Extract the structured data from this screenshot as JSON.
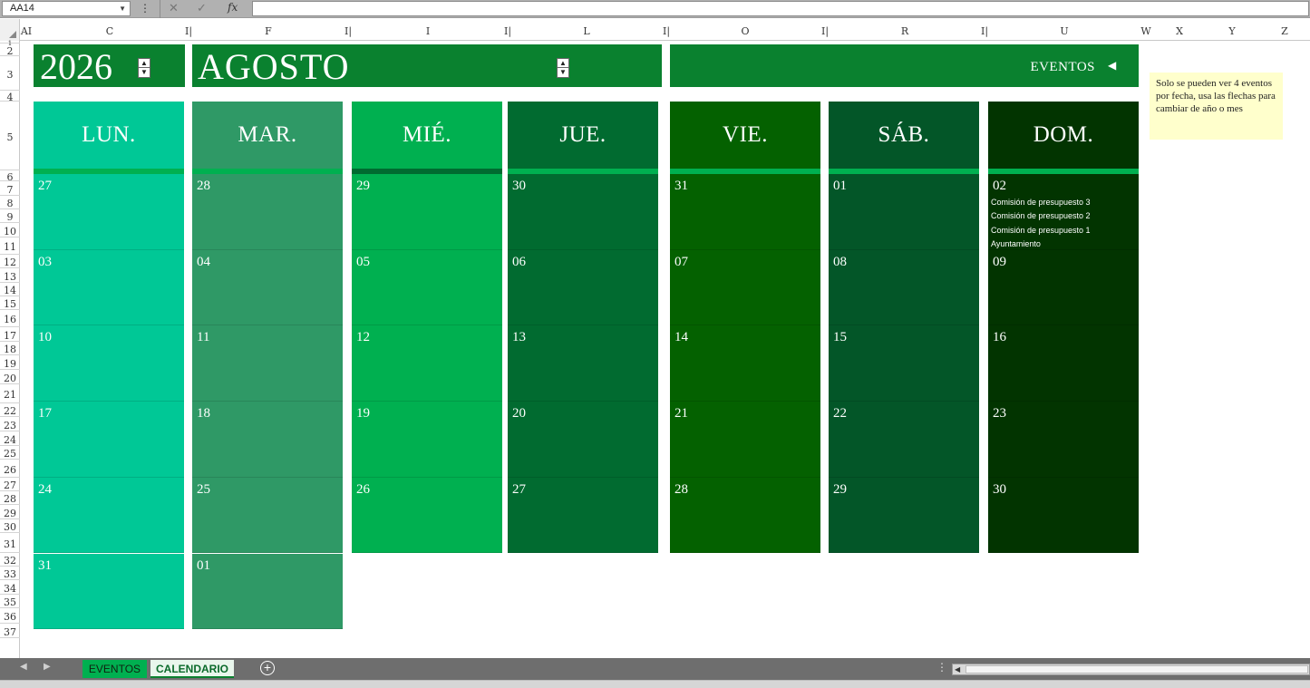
{
  "formula_bar": {
    "name_box": "AA14",
    "cancel_icon": "✕",
    "enter_icon": "✓",
    "fx_label": "fx",
    "formula": ""
  },
  "columns": [
    "AI",
    "C",
    "I|",
    "F",
    "I|",
    "I",
    "I|",
    "L",
    "I|",
    "O",
    "I|",
    "R",
    "I|",
    "U",
    "W",
    "X",
    "Y",
    "Z"
  ],
  "rows": [
    "1",
    "2",
    "3",
    "4",
    "5",
    "6",
    "7",
    "8",
    "9",
    "10",
    "11",
    "12",
    "13",
    "14",
    "15",
    "16",
    "17",
    "18",
    "19",
    "20",
    "21",
    "22",
    "23",
    "24",
    "25",
    "26",
    "27",
    "28",
    "29",
    "30",
    "31",
    "32",
    "33",
    "34",
    "35",
    "36",
    "37"
  ],
  "calendar": {
    "year": "2026",
    "month": "AGOSTO",
    "events_label": "EVENTOS",
    "days": [
      {
        "label": "LUN.",
        "color": "#00c896",
        "stripe": "#00b050"
      },
      {
        "label": "MAR.",
        "color": "#2f9966",
        "stripe": "#00b050"
      },
      {
        "label": "MIÉ.",
        "color": "#00b050",
        "stripe": "#006b30"
      },
      {
        "label": "JUE.",
        "color": "#016b30",
        "stripe": "#00b050"
      },
      {
        "label": "VIE.",
        "color": "#046100",
        "stripe": "#00b050"
      },
      {
        "label": "SÁB.",
        "color": "#035628",
        "stripe": "#00b050"
      },
      {
        "label": "DOM.",
        "color": "#023400",
        "stripe": "#00b050"
      }
    ],
    "weeks": [
      [
        "27",
        "28",
        "29",
        "30",
        "31",
        "01",
        "02"
      ],
      [
        "03",
        "04",
        "05",
        "06",
        "07",
        "08",
        "09"
      ],
      [
        "10",
        "11",
        "12",
        "13",
        "14",
        "15",
        "16"
      ],
      [
        "17",
        "18",
        "19",
        "20",
        "21",
        "22",
        "23"
      ],
      [
        "24",
        "25",
        "26",
        "27",
        "28",
        "29",
        "30"
      ],
      [
        "31",
        "01",
        "",
        "",
        "",
        "",
        ""
      ]
    ],
    "events_on_02": [
      "Comisión de presupuesto 3",
      "Comisión de presupuesto 2",
      "Comisión de presupuesto 1",
      "Ayuntamiento"
    ]
  },
  "note": "Solo se pueden ver 4 eventos por fecha, usa las flechas para cambiar de año o mes",
  "sheet_tabs": {
    "eventos": "EVENTOS",
    "calendario": "CALENDARIO",
    "active": "CALENDARIO"
  }
}
